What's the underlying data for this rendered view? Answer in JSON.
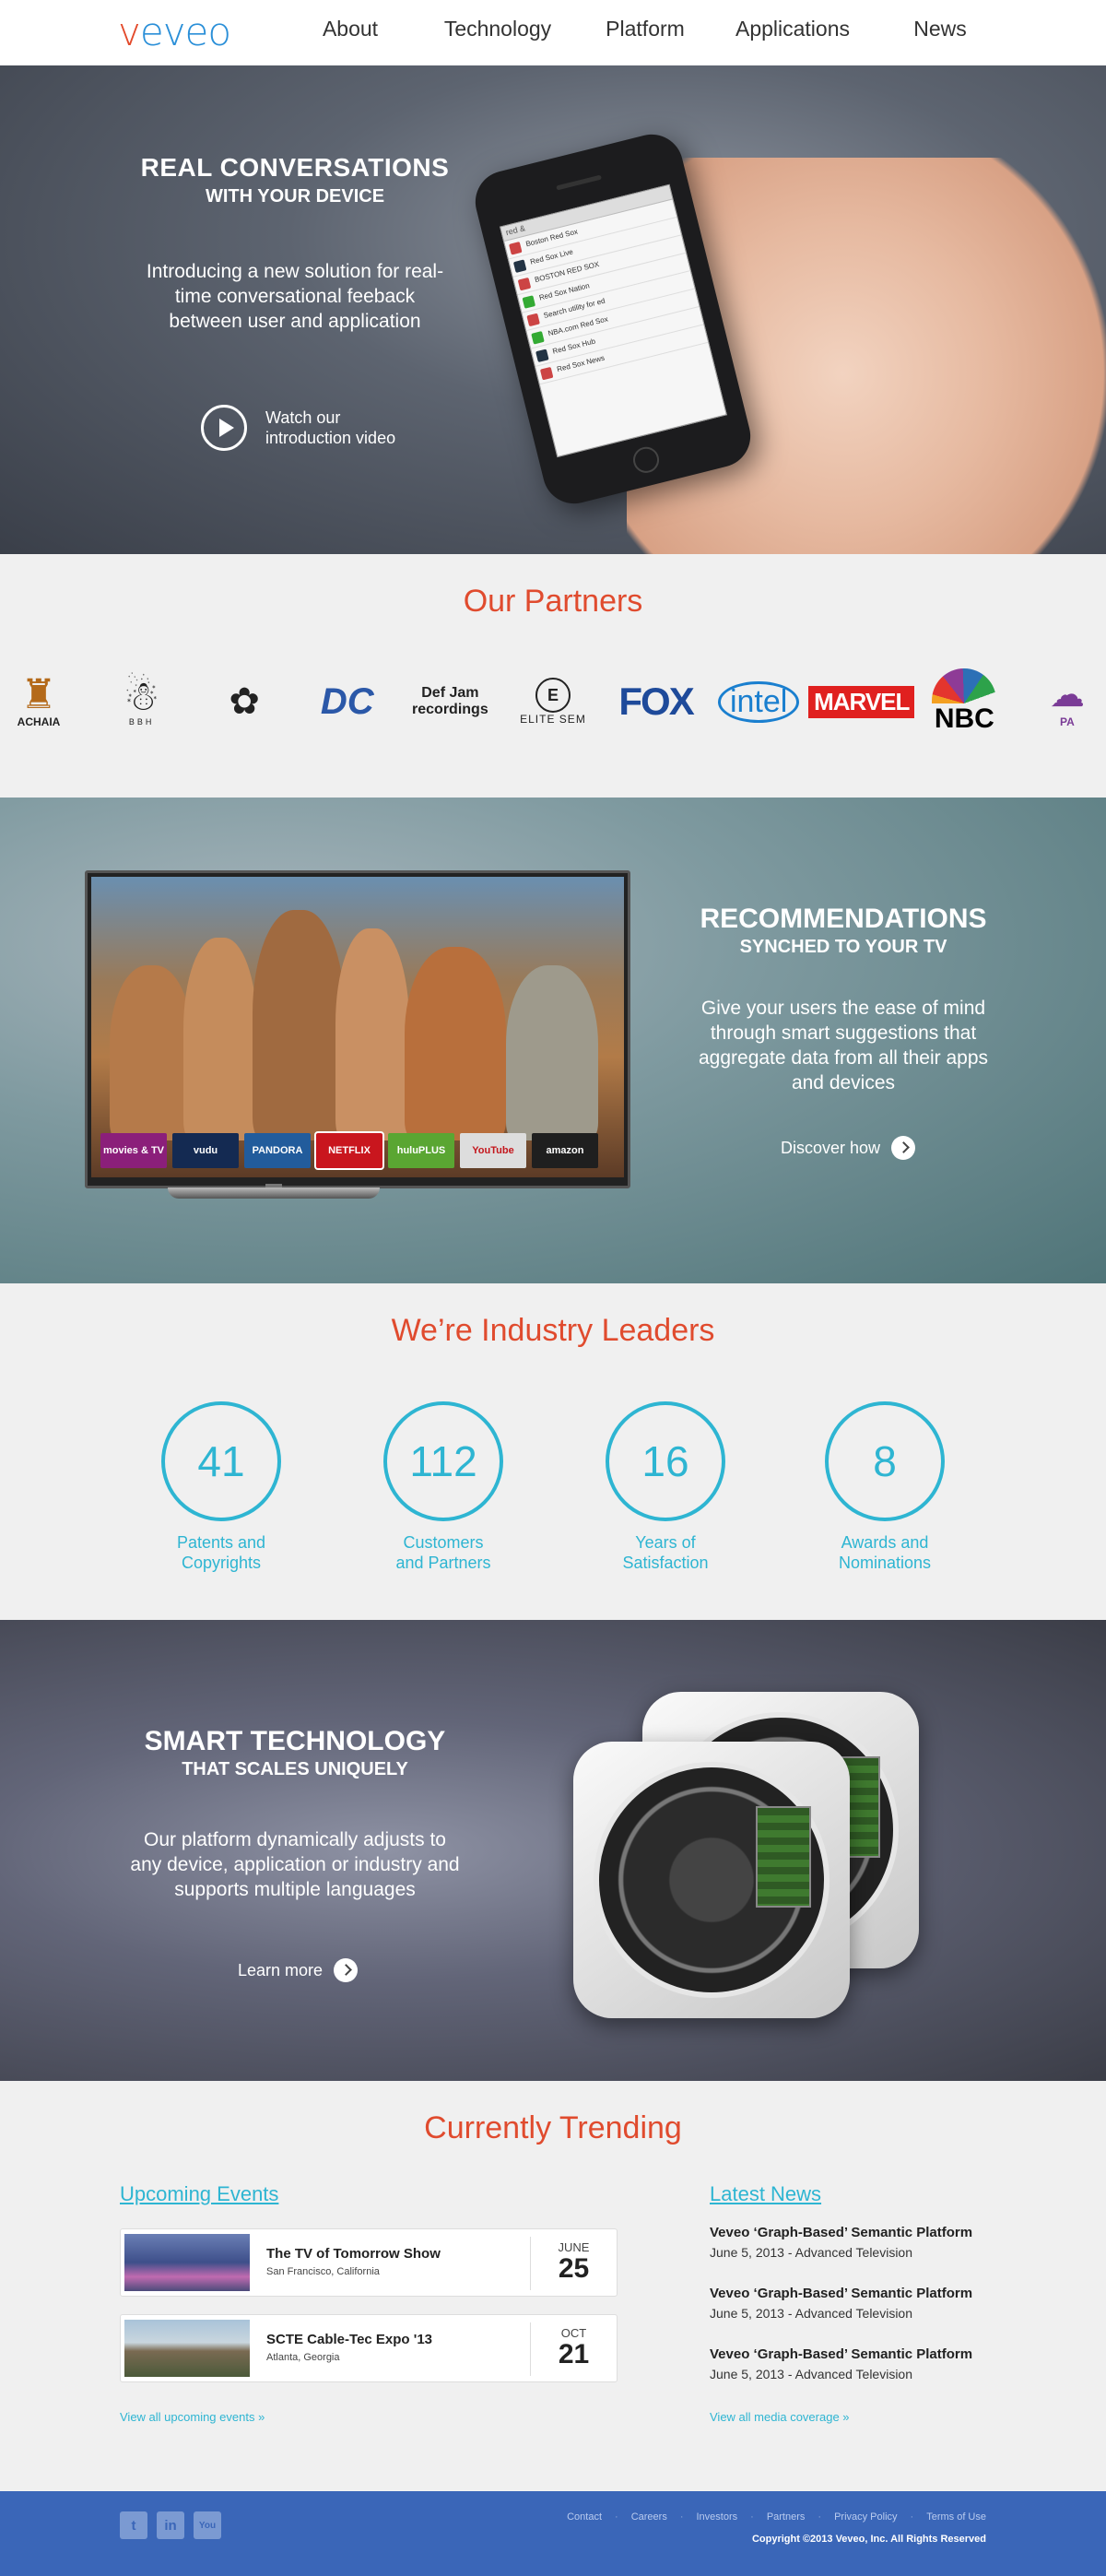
{
  "logo": {
    "v": "v",
    "rest": "eveo"
  },
  "nav": [
    "About",
    "Technology",
    "Platform",
    "Applications",
    "News"
  ],
  "hero": {
    "title": "REAL CONVERSATIONS",
    "subtitle": "WITH YOUR DEVICE",
    "text": "Introducing a new solution for real-time conversational feeback between user and application",
    "video_line1": "Watch our",
    "video_line2": "introduction video"
  },
  "phone": {
    "search": "red &",
    "rows": [
      "Boston Red Sox",
      "Red Sox Live",
      "BOSTON RED SOX",
      "Red Sox Nation",
      "Search utility for ed",
      "NBA.com Red Sox",
      "Red Sox Hub",
      "Red Sox News"
    ]
  },
  "partners": {
    "title": "Our Partners",
    "logos": [
      "ACHAIA",
      "BBH",
      "",
      "DC",
      "Def Jam recordings",
      "ELITE SEM",
      "FOX",
      "intel",
      "MARVEL",
      "NBC",
      "PA"
    ]
  },
  "reco": {
    "title": "RECOMMENDATIONS",
    "subtitle": "SYNCHED TO YOUR TV",
    "text": "Give your users the ease of mind through smart suggestions that aggregate data from all their apps and devices",
    "cta": "Discover how",
    "apps": [
      {
        "label": "movies & TV",
        "color": "#8b1f7a"
      },
      {
        "label": "vudu",
        "color": "#142a52"
      },
      {
        "label": "PANDORA",
        "color": "#225c9c"
      },
      {
        "label": "NETFLIX",
        "color": "#c9161e"
      },
      {
        "label": "huluPLUS",
        "color": "#5aa632"
      },
      {
        "label": "YouTube",
        "color": "#dddddd"
      },
      {
        "label": "amazon",
        "color": "#1f1f1f"
      }
    ]
  },
  "stats": {
    "title": "We’re Industry Leaders",
    "items": [
      {
        "value": "41",
        "label": "Patents and\nCopyrights"
      },
      {
        "value": "112",
        "label": "Customers\nand Partners"
      },
      {
        "value": "16",
        "label": "Years of\nSatisfaction"
      },
      {
        "value": "8",
        "label": "Awards and\nNominations"
      }
    ]
  },
  "smart": {
    "title": "SMART TECHNOLOGY",
    "subtitle": "THAT SCALES UNIQUELY",
    "text": "Our platform dynamically adjusts to any device, application or industry and supports multiple languages",
    "cta": "Learn more"
  },
  "trending": {
    "title": "Currently Trending",
    "events_title": "Upcoming Events",
    "events": [
      {
        "name": "The TV of Tomorrow Show",
        "location": "San Francisco, California",
        "month": "JUNE",
        "day": "25"
      },
      {
        "name": "SCTE Cable-Tec Expo '13",
        "location": "Atlanta, Georgia",
        "month": "OCT",
        "day": "21"
      }
    ],
    "events_link": "View all upcoming events »",
    "news_title": "Latest News",
    "news": [
      {
        "title": "Veveo ‘Graph-Based’ Semantic Platform",
        "date": "June 5, 2013 - Advanced Television"
      },
      {
        "title": "Veveo ‘Graph-Based’ Semantic Platform",
        "date": "June 5, 2013 - Advanced Television"
      },
      {
        "title": "Veveo ‘Graph-Based’ Semantic Platform",
        "date": "June 5, 2013 - Advanced Television"
      }
    ],
    "news_link": "View all media coverage »"
  },
  "footer": {
    "social": [
      "t",
      "in",
      "You"
    ],
    "links": [
      "Contact",
      "Careers",
      "Investors",
      "Partners",
      "Privacy Policy",
      "Terms of Use"
    ],
    "copyright": "Copyright ©2013 Veveo, Inc. All Rights Reserved"
  }
}
